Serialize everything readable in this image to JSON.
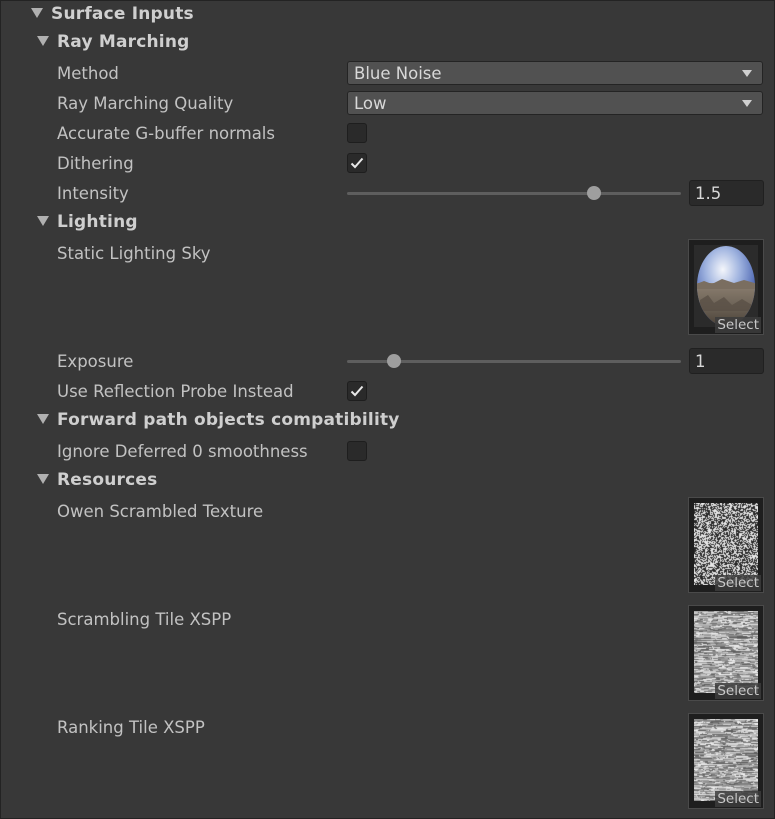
{
  "sections": {
    "surface_inputs": "Surface Inputs",
    "ray_marching": "Ray Marching",
    "lighting": "Lighting",
    "forward": "Forward path objects compatibility",
    "resources": "Resources"
  },
  "ray_marching": {
    "method_label": "Method",
    "method_value": "Blue Noise",
    "quality_label": "Ray Marching Quality",
    "quality_value": "Low",
    "accurate_label": "Accurate G-buffer normals",
    "accurate_checked": false,
    "dithering_label": "Dithering",
    "dithering_checked": true,
    "intensity_label": "Intensity",
    "intensity_value": "1.5",
    "intensity_slider_fraction": 0.74
  },
  "lighting": {
    "sky_label": "Static Lighting Sky",
    "sky_select": "Select",
    "exposure_label": "Exposure",
    "exposure_value": "1",
    "exposure_slider_fraction": 0.14,
    "reflection_label": "Use Reflection Probe Instead",
    "reflection_checked": true
  },
  "forward": {
    "ignore_label": "Ignore Deferred 0 smoothness",
    "ignore_checked": false
  },
  "resources": {
    "owen_label": "Owen Scrambled Texture",
    "owen_select": "Select",
    "scrambling_label": "Scrambling Tile XSPP",
    "scrambling_select": "Select",
    "ranking_label": "Ranking Tile XSPP",
    "ranking_select": "Select"
  },
  "colors": {
    "background": "#383838",
    "field": "#2a2a2a",
    "dropdown": "#515151"
  }
}
